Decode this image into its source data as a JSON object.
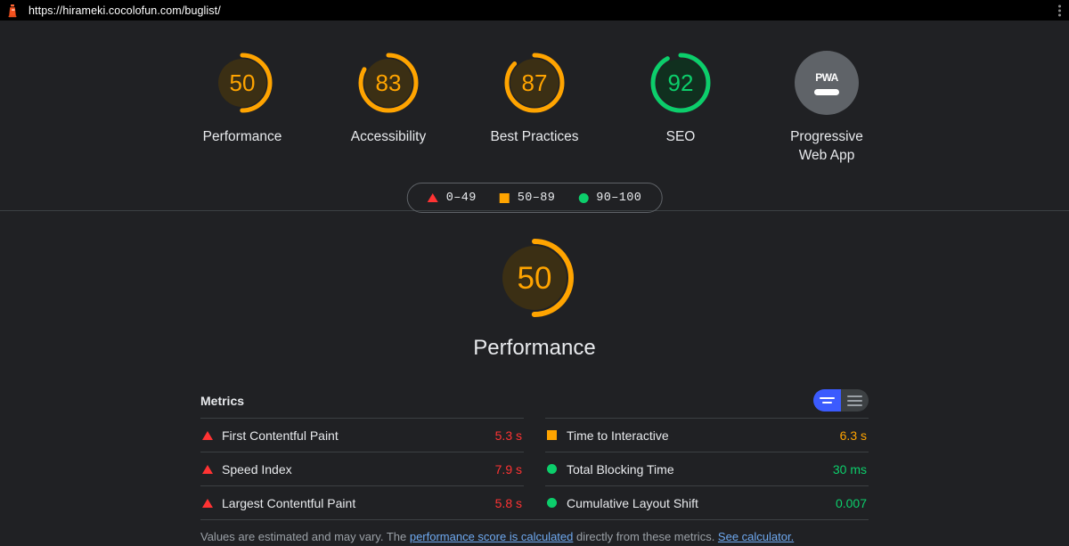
{
  "browser": {
    "url": "https://hirameki.cocolofun.com/buglist/",
    "favicon_name": "lighthouse-icon",
    "menu_name": "browser-menu-icon"
  },
  "scores": [
    {
      "label": "Performance",
      "value": "50",
      "pct": 50,
      "color": "#ffa400",
      "track": "#3b2f14"
    },
    {
      "label": "Accessibility",
      "value": "83",
      "pct": 83,
      "color": "#ffa400",
      "track": "#3b2f14"
    },
    {
      "label": "Best Practices",
      "value": "87",
      "pct": 87,
      "color": "#ffa400",
      "track": "#3b2f14"
    },
    {
      "label": "SEO",
      "value": "92",
      "pct": 92,
      "color": "#0cce6b",
      "track": "#10301f"
    },
    {
      "label": "Progressive\nWeb App",
      "value": "PWA",
      "pct": 0,
      "color": "#5f6368",
      "track": "#5f6368"
    }
  ],
  "legend": {
    "items": [
      {
        "shape": "triangle",
        "range": "0–49",
        "color": "#f33"
      },
      {
        "shape": "square",
        "range": "50–89",
        "color": "#ffa400"
      },
      {
        "shape": "circle",
        "range": "90–100",
        "color": "#0cce6b"
      }
    ]
  },
  "category": {
    "title": "Performance",
    "score": "50",
    "pct": 50,
    "color": "#ffa400"
  },
  "metrics": {
    "heading": "Metrics",
    "toggle": {
      "left_name": "simple-view-toggle",
      "right_name": "expanded-view-toggle",
      "selected": "left"
    },
    "left_column": [
      {
        "name": "First Contentful Paint",
        "value": "5.3 s",
        "status": "fail",
        "shape": "triangle"
      },
      {
        "name": "Speed Index",
        "value": "7.9 s",
        "status": "fail",
        "shape": "triangle"
      },
      {
        "name": "Largest Contentful Paint",
        "value": "5.8 s",
        "status": "fail",
        "shape": "triangle"
      }
    ],
    "right_column": [
      {
        "name": "Time to Interactive",
        "value": "6.3 s",
        "status": "average",
        "shape": "square"
      },
      {
        "name": "Total Blocking Time",
        "value": "30 ms",
        "status": "pass",
        "shape": "circle"
      },
      {
        "name": "Cumulative Layout Shift",
        "value": "0.007",
        "status": "pass",
        "shape": "circle"
      }
    ],
    "footer": {
      "text_1": "Values are estimated and may vary. The ",
      "link_1": "performance score is calculated",
      "text_2": " directly from these metrics. ",
      "link_2": "See calculator."
    }
  }
}
